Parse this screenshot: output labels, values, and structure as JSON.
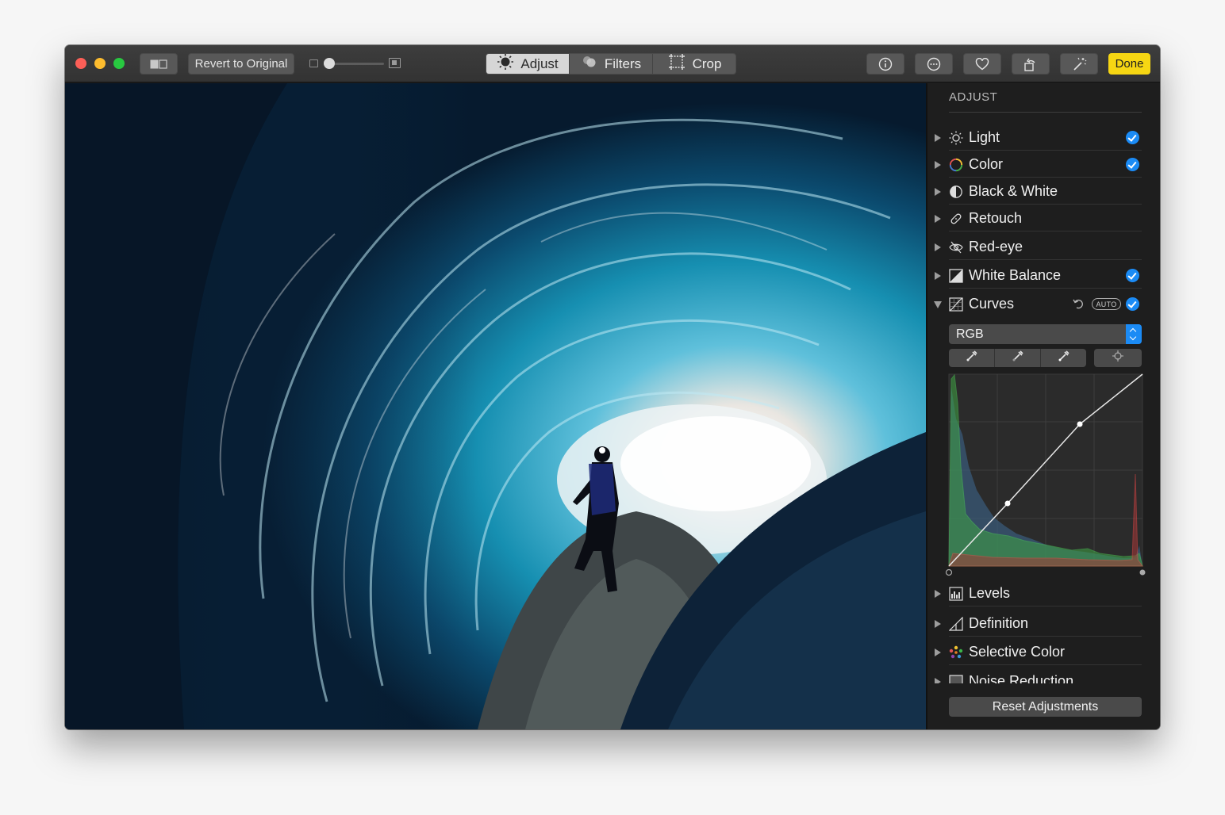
{
  "toolbar": {
    "revert_label": "Revert to Original",
    "tabs": [
      {
        "label": "Adjust",
        "active": true
      },
      {
        "label": "Filters",
        "active": false
      },
      {
        "label": "Crop",
        "active": false
      }
    ],
    "done_label": "Done",
    "icons": [
      "split-view-icon",
      "info-icon",
      "more-icon",
      "heart-icon",
      "rotate-icon",
      "magic-wand-icon"
    ]
  },
  "sidebar": {
    "title": "ADJUST",
    "items": [
      {
        "label": "Light",
        "checked": true
      },
      {
        "label": "Color",
        "checked": true
      },
      {
        "label": "Black & White",
        "checked": false
      },
      {
        "label": "Retouch",
        "checked": false
      },
      {
        "label": "Red-eye",
        "checked": false
      },
      {
        "label": "White Balance",
        "checked": true
      },
      {
        "label": "Curves",
        "checked": true,
        "expanded": true
      }
    ],
    "curves": {
      "auto_label": "AUTO",
      "channel": "RGB"
    },
    "items_below": [
      {
        "label": "Levels"
      },
      {
        "label": "Definition"
      },
      {
        "label": "Selective Color"
      },
      {
        "label": "Noise Reduction"
      }
    ],
    "reset_label": "Reset Adjustments"
  },
  "colors": {
    "accent_blue": "#1b8bf5",
    "done_yellow": "#f6d613"
  }
}
